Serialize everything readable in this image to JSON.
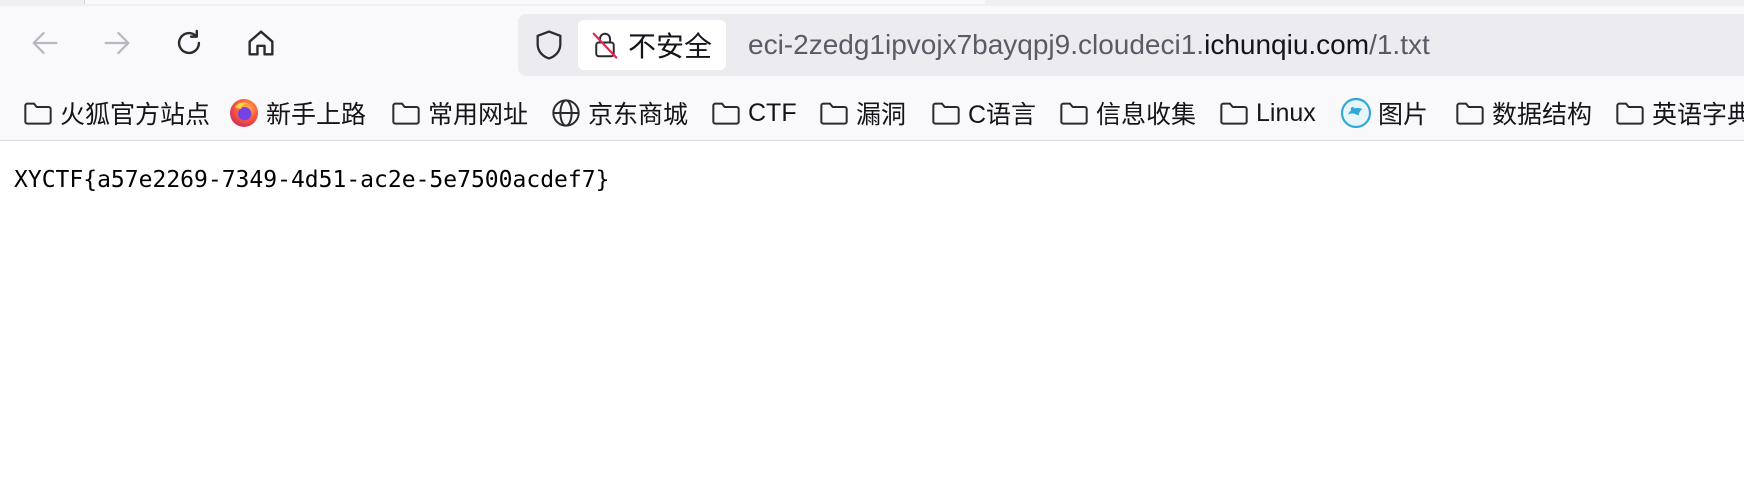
{
  "nav": {
    "back_icon": "arrow-left-icon",
    "forward_icon": "arrow-right-icon",
    "reload_icon": "reload-icon",
    "home_icon": "home-icon"
  },
  "urlbar": {
    "security_label": "不安全",
    "url_prefix": "eci-2zedg1ipvojx7bayqpj9.cloudeci1.",
    "url_domain": "ichunqiu.com",
    "url_suffix": "/1.txt"
  },
  "bookmarks": [
    {
      "label": "火狐官方站点",
      "icon": "folder-icon"
    },
    {
      "label": "新手上路",
      "icon": "firefox-icon"
    },
    {
      "label": "常用网址",
      "icon": "folder-icon"
    },
    {
      "label": "京东商城",
      "icon": "globe-icon"
    },
    {
      "label": "CTF",
      "icon": "folder-icon"
    },
    {
      "label": "漏洞",
      "icon": "folder-icon"
    },
    {
      "label": "C语言",
      "icon": "folder-icon"
    },
    {
      "label": "信息收集",
      "icon": "folder-icon"
    },
    {
      "label": "Linux",
      "icon": "folder-icon"
    },
    {
      "label": "图片",
      "icon": "favicon-icon"
    },
    {
      "label": "数据结构",
      "icon": "folder-icon"
    },
    {
      "label": "英语字典",
      "icon": "folder-icon"
    }
  ],
  "document": {
    "text": "XYCTF{a57e2269-7349-4d51-ac2e-5e7500acdef7}"
  },
  "colors": {
    "toolbar_bg": "#f9f9fb",
    "urlbar_bg": "#ececf0",
    "insecure_slash": "#e22850"
  }
}
